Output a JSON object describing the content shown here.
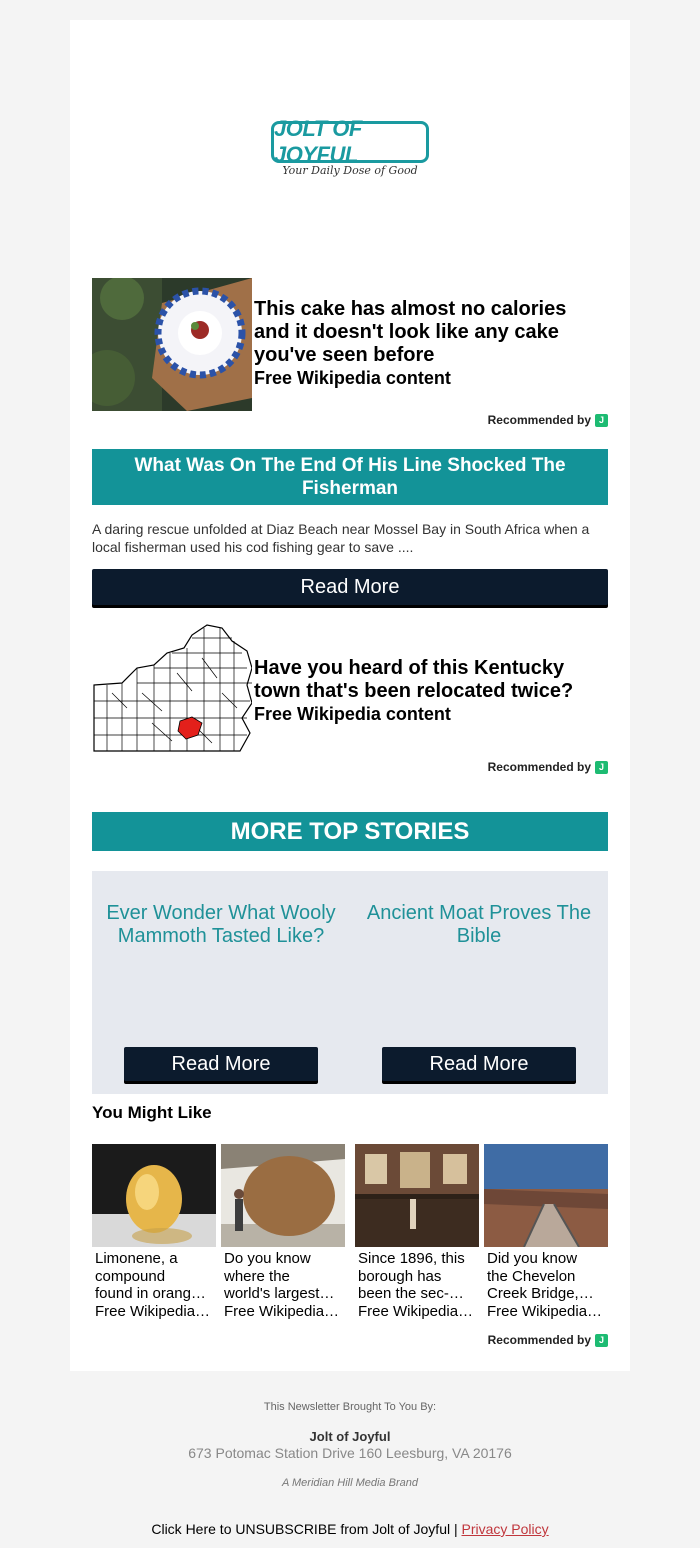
{
  "brand": {
    "logo_text": "JOLT OF JOYFUL",
    "tagline": "Your Daily Dose of Good"
  },
  "promo1": {
    "title_lines": [
      "This cake has almost no calories",
      "and it doesn't look like any cake",
      "you've seen before"
    ],
    "source": "Free Wikipedia content",
    "recommended_by": "Recommended by"
  },
  "story": {
    "headline": "What Was On The End Of His Line Shocked The Fisherman",
    "excerpt": "A daring rescue unfolded at Diaz Beach near Mossel Bay in South Africa when a local fisherman used his cod fishing gear to save ....",
    "read_more": "Read More"
  },
  "promo2": {
    "title_lines": [
      "Have you heard of this Kentucky",
      "town that's been relocated twice?"
    ],
    "source": "Free Wikipedia content",
    "recommended_by": "Recommended by"
  },
  "more_top_stories": {
    "heading": "MORE TOP STORIES",
    "items": [
      {
        "title": "Ever Wonder What Wooly Mammoth Tasted Like?",
        "button": "Read More"
      },
      {
        "title": "Ancient Moat Proves The Bible",
        "button": "Read More"
      }
    ]
  },
  "you_might_like": {
    "heading": "You Might Like",
    "items": [
      {
        "lines": [
          "Limonene, a",
          "compound",
          "found in orang…"
        ],
        "source": "Free Wikipedia …"
      },
      {
        "lines": [
          "Do you know",
          "where the",
          "world's largest…"
        ],
        "source": "Free Wikipedia …"
      },
      {
        "lines": [
          "Since 1896, this",
          "borough has",
          "been the sec-…"
        ],
        "source": "Free Wikipedia …"
      },
      {
        "lines": [
          "Did you know",
          "the Chevelon",
          "Creek Bridge,…"
        ],
        "source": "Free Wikipedia …"
      }
    ],
    "recommended_by": "Recommended by"
  },
  "footer": {
    "brought_by": "This Newsletter Brought To You By:",
    "company": "Jolt of Joyful",
    "address": "673 Potomac Station Drive 160 Leesburg, VA 20176",
    "brand_line": "A Meridian Hill Media Brand",
    "unsubscribe": "Click Here to UNSUBSCRIBE from Jolt of Joyful |",
    "privacy": "Privacy Policy"
  },
  "colors": {
    "teal": "#139398",
    "navy_button": "#0c1b2d",
    "story_link": "#1f9198",
    "grey_box": "#e6e9ef"
  }
}
